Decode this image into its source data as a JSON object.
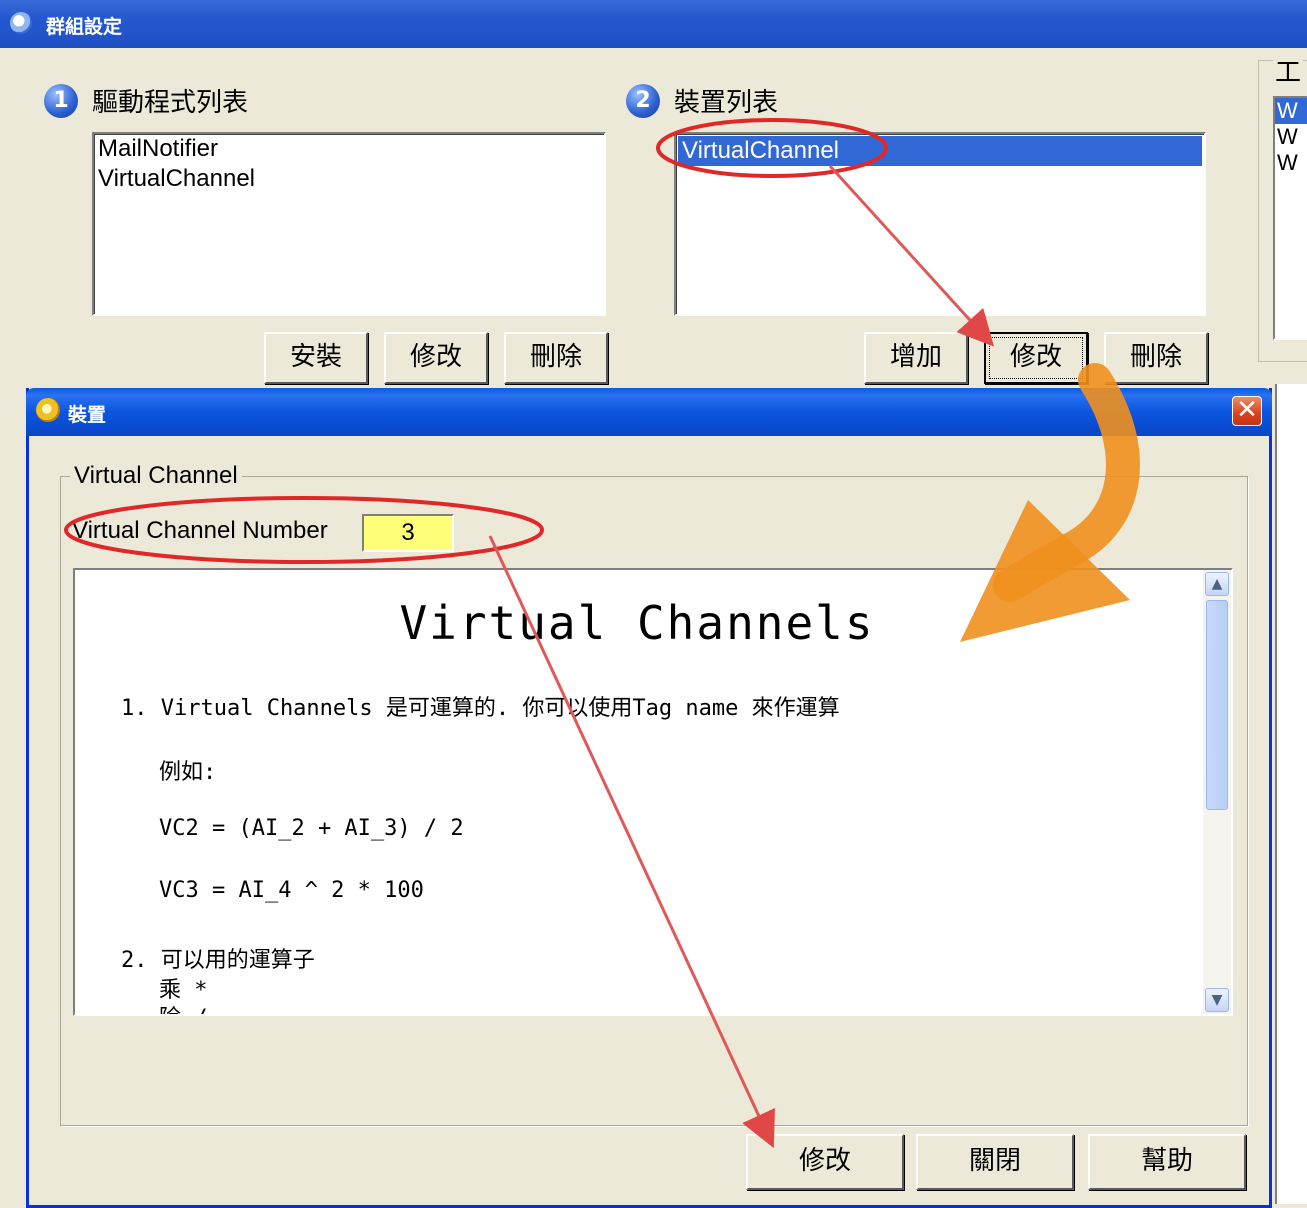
{
  "main_window": {
    "title": "群組設定",
    "section1": {
      "number": "1",
      "title": "驅動程式列表"
    },
    "drivers": [
      "MailNotifier",
      "VirtualChannel"
    ],
    "driver_buttons": {
      "install": "安裝",
      "modify": "修改",
      "delete": "刪除"
    },
    "section2": {
      "number": "2",
      "title": "裝置列表"
    },
    "devices": [
      "VirtualChannel"
    ],
    "device_buttons": {
      "add": "增加",
      "modify": "修改",
      "delete": "刪除"
    },
    "right_panel": {
      "label": "工",
      "items": [
        "W",
        "W",
        "W"
      ]
    }
  },
  "dialog": {
    "title": "裝置",
    "close_label": "✕",
    "group_title": "Virtual Channel",
    "vc_number_label": "Virtual Channel Number",
    "vc_number_value": "3",
    "help": {
      "title": "Virtual Channels",
      "lines": [
        "1. Virtual Channels 是可運算的. 你可以使用Tag name 來作運算",
        "例如:",
        "VC2 = (AI_2 + AI_3) / 2",
        "VC3 = AI_4 ^ 2 * 100",
        "2. 可以用的運算子",
        "乘 *",
        "除 /"
      ]
    },
    "buttons": {
      "modify": "修改",
      "close": "關閉",
      "help": "幫助"
    }
  },
  "colors": {
    "annotation_red": "#e03030",
    "arrow_orange": "#f0901e",
    "selection_blue": "#3168d5",
    "input_yellow": "#ffff7a"
  }
}
